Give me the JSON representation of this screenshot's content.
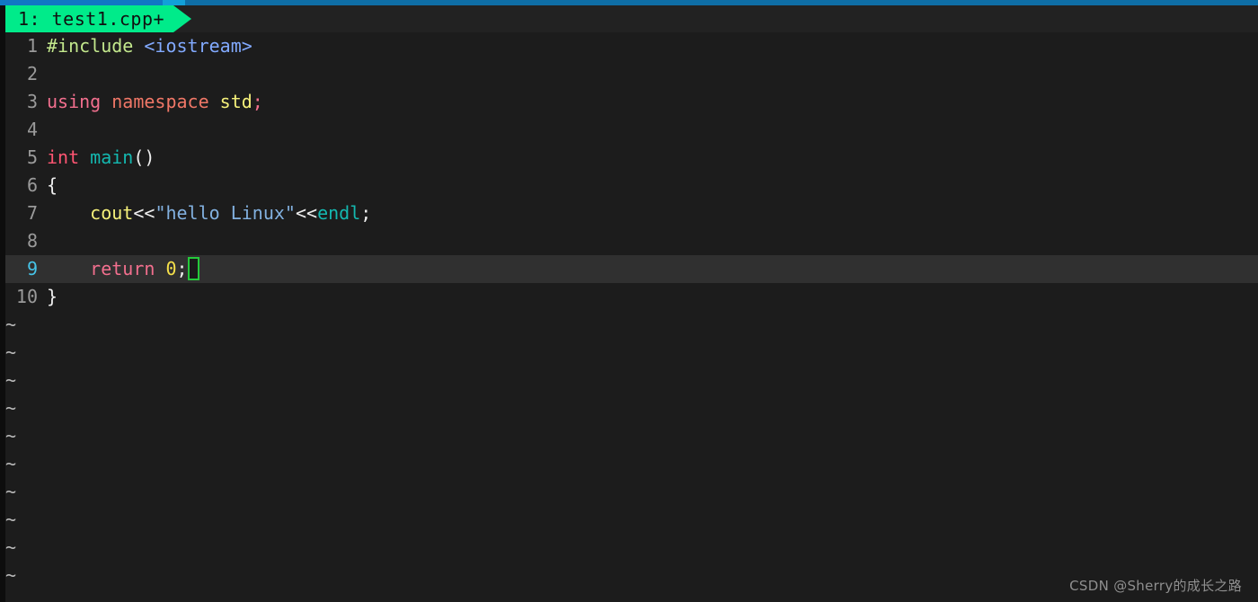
{
  "window": {
    "top_strip_color": "#1177c4",
    "background_color": "#1c1c1c"
  },
  "tabline": {
    "active_tab": {
      "label": "1: test1.cpp+",
      "buffer_number": "1",
      "file_name": "test1.cpp",
      "modified_flag": "+",
      "background_color": "#00eb8a",
      "text_color": "#101010"
    }
  },
  "editor": {
    "current_line_number": 9,
    "current_line_highlight_color": "#303030",
    "cursor_color": "#25c93b",
    "line_number_color": "#9a9a9a",
    "current_line_number_color": "#46c4e8",
    "lines": [
      {
        "num": "1",
        "tokens": [
          {
            "text": "#include ",
            "cls": "t-pre"
          },
          {
            "text": "<iostream>",
            "cls": "t-header"
          }
        ]
      },
      {
        "num": "2",
        "tokens": []
      },
      {
        "num": "3",
        "tokens": [
          {
            "text": "using ",
            "cls": "t-using"
          },
          {
            "text": "namespace ",
            "cls": "t-ns"
          },
          {
            "text": "std",
            "cls": "t-type"
          },
          {
            "text": ";",
            "cls": "t-punct"
          }
        ]
      },
      {
        "num": "4",
        "tokens": []
      },
      {
        "num": "5",
        "tokens": [
          {
            "text": "int ",
            "cls": "t-kw2"
          },
          {
            "text": "main",
            "cls": "t-func"
          },
          {
            "text": "()",
            "cls": "t-paren"
          }
        ]
      },
      {
        "num": "6",
        "tokens": [
          {
            "text": "{",
            "cls": "t-brace"
          }
        ]
      },
      {
        "num": "7",
        "tokens": [
          {
            "text": "    ",
            "cls": "t-op"
          },
          {
            "text": "cout",
            "cls": "t-stream"
          },
          {
            "text": "<<",
            "cls": "t-op"
          },
          {
            "text": "\"hello Linux\"",
            "cls": "t-string"
          },
          {
            "text": "<<",
            "cls": "t-op"
          },
          {
            "text": "endl",
            "cls": "t-endl"
          },
          {
            "text": ";",
            "cls": "t-semi"
          }
        ]
      },
      {
        "num": "8",
        "tokens": []
      },
      {
        "num": "9",
        "current": true,
        "tokens": [
          {
            "text": "    ",
            "cls": "t-op"
          },
          {
            "text": "return ",
            "cls": "t-return"
          },
          {
            "text": "0",
            "cls": "t-num"
          },
          {
            "text": ";",
            "cls": "t-semi"
          }
        ],
        "cursor_after": true
      },
      {
        "num": "10",
        "tokens": [
          {
            "text": "}",
            "cls": "t-brace"
          }
        ]
      }
    ],
    "empty_line_marker": "~",
    "empty_line_count": 10
  },
  "watermark": {
    "text": "CSDN @Sherry的成长之路"
  }
}
